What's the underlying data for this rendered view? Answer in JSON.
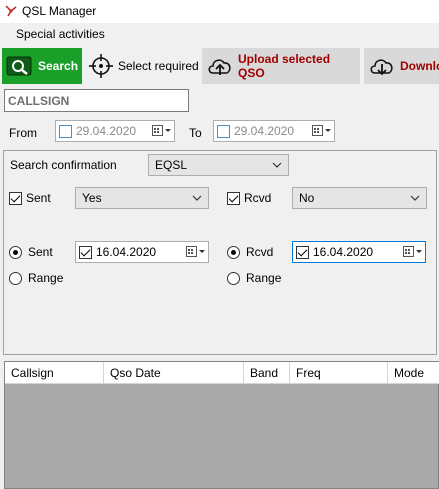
{
  "window": {
    "title": "QSL Manager"
  },
  "menu": {
    "items": [
      "Special activities"
    ]
  },
  "toolbar": {
    "search_label": "Search",
    "select_label": "Select required",
    "upload_label": "Upload selected QSO",
    "download_label": "Downlo"
  },
  "filters": {
    "callsign_value": "CALLSIGN",
    "from_label": "From",
    "from_date": "29.04.2020",
    "from_checked": false,
    "to_label": "To",
    "to_date": "29.04.2020",
    "to_checked": false
  },
  "confirmation": {
    "label": "Search confirmation",
    "selected": "EQSL",
    "sent_label": "Sent",
    "sent_checked": true,
    "sent_value": "Yes",
    "rcvd_label": "Rcvd",
    "rcvd_checked": true,
    "rcvd_value": "No",
    "sent_date_radio_label": "Sent",
    "sent_date": "16.04.2020",
    "sent_range_label": "Range",
    "rcvd_date_radio_label": "Rcvd",
    "rcvd_date": "16.04.2020",
    "rcvd_range_label": "Range"
  },
  "grid": {
    "columns": [
      "Callsign",
      "Qso Date",
      "Band",
      "Freq",
      "Mode"
    ]
  },
  "colors": {
    "search_button": "#1aa028",
    "upload_text": "#a00000"
  }
}
